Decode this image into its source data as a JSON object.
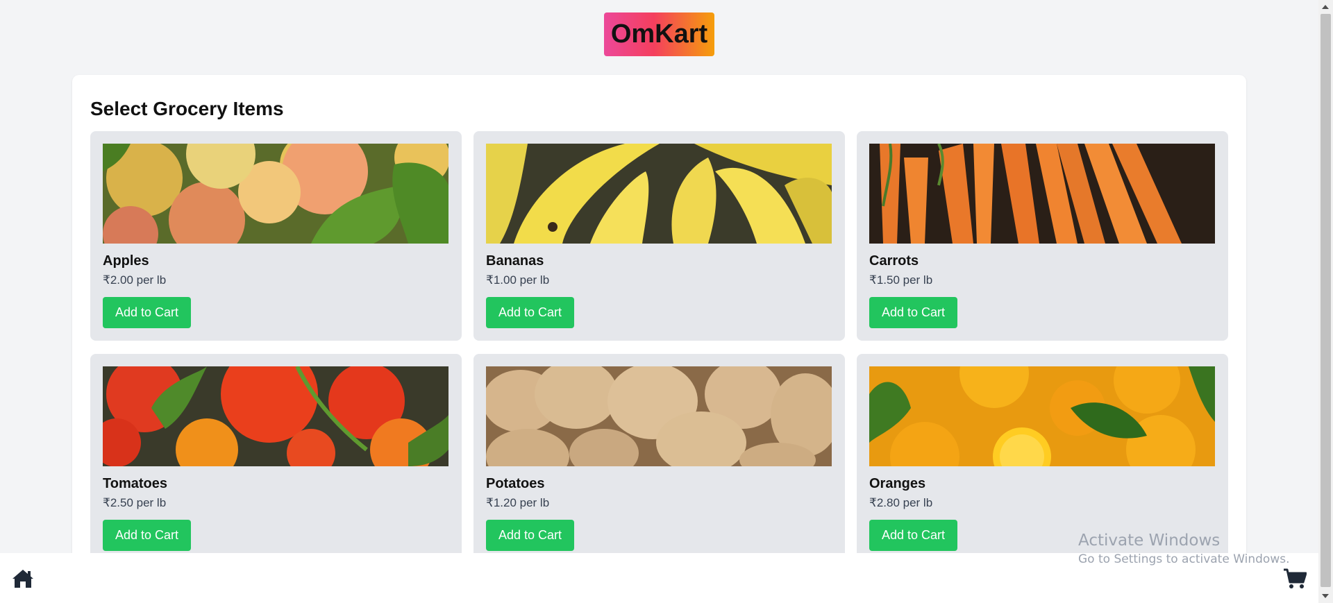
{
  "header": {
    "logo_text": "OmKart"
  },
  "main": {
    "title": "Select Grocery Items",
    "items": [
      {
        "name": "Apples",
        "price": "₹2.00 per lb",
        "button": "Add to Cart",
        "image": "apples-photo"
      },
      {
        "name": "Bananas",
        "price": "₹1.00 per lb",
        "button": "Add to Cart",
        "image": "bananas-photo"
      },
      {
        "name": "Carrots",
        "price": "₹1.50 per lb",
        "button": "Add to Cart",
        "image": "carrots-photo"
      },
      {
        "name": "Tomatoes",
        "price": "₹2.50 per lb",
        "button": "Add to Cart",
        "image": "tomatoes-photo"
      },
      {
        "name": "Potatoes",
        "price": "₹1.20 per lb",
        "button": "Add to Cart",
        "image": "potatoes-photo"
      },
      {
        "name": "Oranges",
        "price": "₹2.80 per lb",
        "button": "Add to Cart",
        "image": "oranges-photo"
      }
    ]
  },
  "bottom_nav": {
    "home_icon": "home-icon",
    "cart_icon": "cart-icon"
  },
  "watermark": {
    "line1": "Activate Windows",
    "line2": "Go to Settings to activate Windows."
  },
  "colors": {
    "button": "#22c55e",
    "card": "#e5e7eb",
    "page": "#f3f4f6",
    "logo_gradient_start": "#ec4899",
    "logo_gradient_end": "#f59e0b"
  }
}
